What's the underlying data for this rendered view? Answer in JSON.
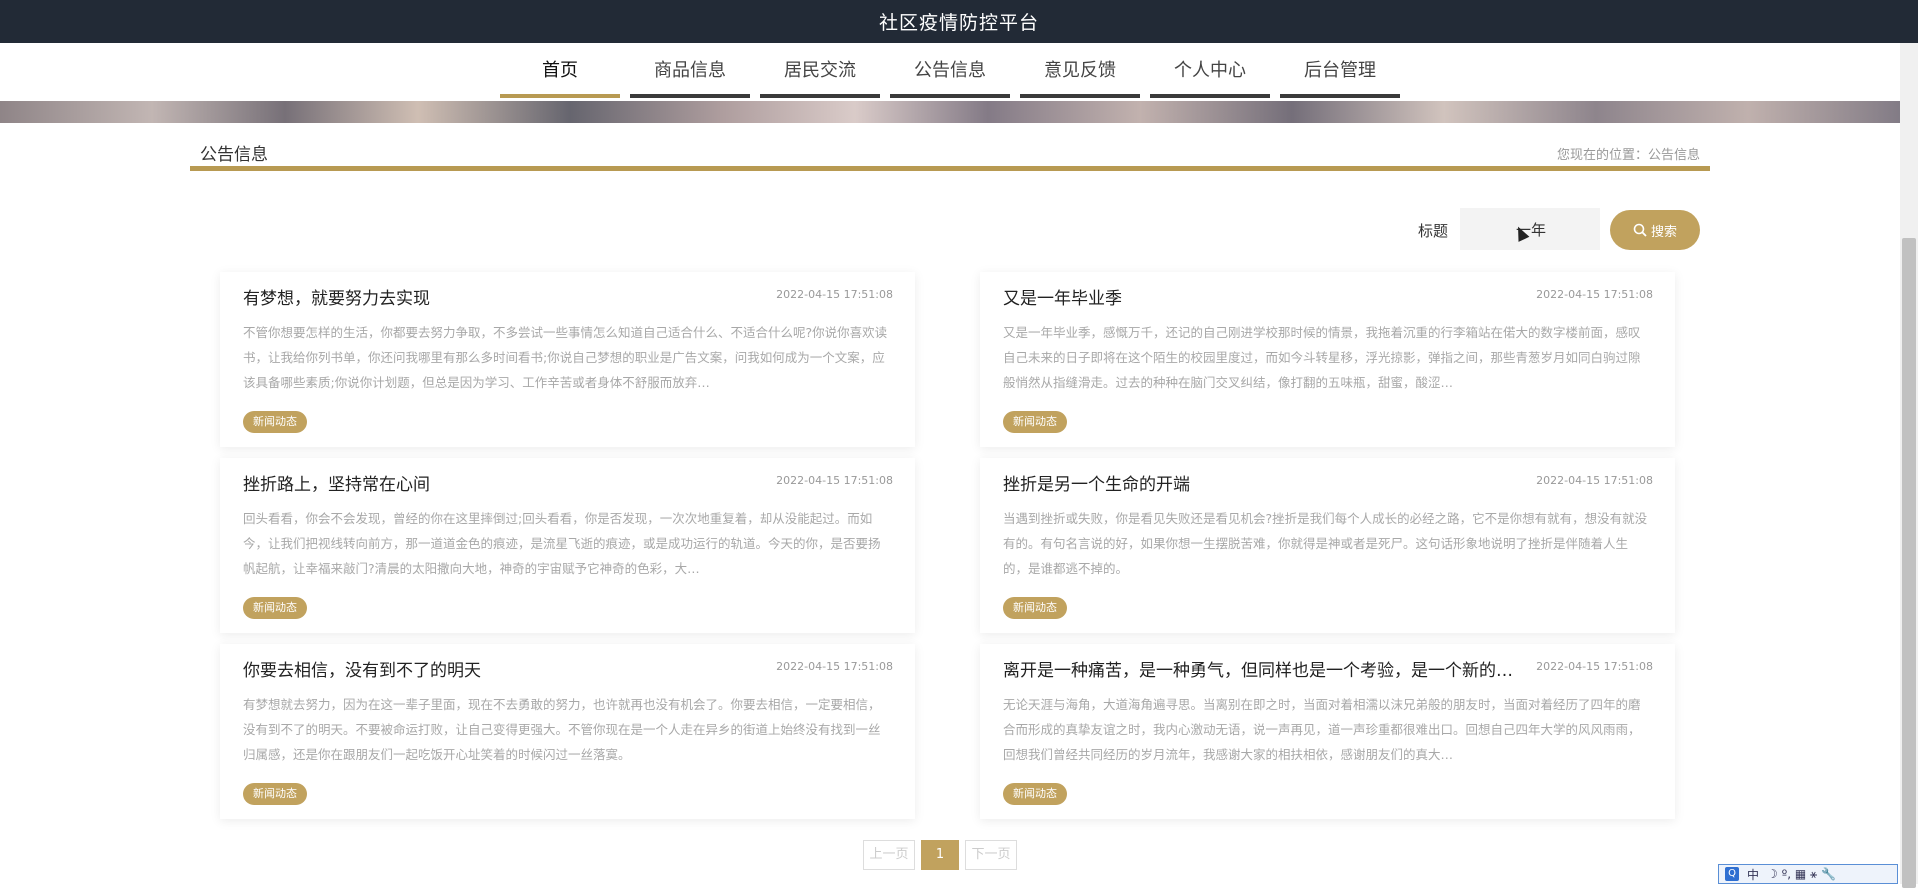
{
  "header": {
    "title": "社区疫情防控平台"
  },
  "nav": {
    "items": [
      "首页",
      "商品信息",
      "居民交流",
      "公告信息",
      "意见反馈",
      "个人中心",
      "后台管理"
    ]
  },
  "section": {
    "title": "公告信息",
    "breadcrumb": "您现在的位置：公告信息"
  },
  "search": {
    "label": "标题",
    "value": "一年",
    "button_label": "搜索"
  },
  "cards": [
    {
      "title": "有梦想，就要努力去实现",
      "date": "2022-04-15 17:51:08",
      "body": "不管你想要怎样的生活，你都要去努力争取，不多尝试一些事情怎么知道自己适合什么、不适合什么呢?你说你喜欢读书，让我给你列书单，你还问我哪里有那么多时间看书;你说自己梦想的职业是广告文案，问我如何成为一个文案，应该具备哪些素质;你说你计划题，但总是因为学习、工作辛苦或者身体不舒服而放弃…",
      "tag": "新闻动态"
    },
    {
      "title": "又是一年毕业季",
      "date": "2022-04-15 17:51:08",
      "body": "又是一年毕业季，感慨万千，还记的自己刚进学校那时候的情景，我拖着沉重的行李箱站在偌大的数字楼前面，感叹自己未来的日子即将在这个陌生的校园里度过，而如今斗转星移，浮光掠影，弹指之间，那些青葱岁月如同白驹过隙般悄然从指缝滑走。过去的种种在脑门交叉纠结，像打翻的五味瓶，甜蜜，酸涩…",
      "tag": "新闻动态"
    },
    {
      "title": "挫折路上，坚持常在心间",
      "date": "2022-04-15 17:51:08",
      "body": "回头看看，你会不会发现，曾经的你在这里摔倒过;回头看看，你是否发现，一次次地重复着，却从没能起过。而如今，让我们把视线转向前方，那一道道金色的痕迹，是流星飞逝的痕迹，或是成功运行的轨道。今天的你，是否要扬帆起航，让幸福来敲门?清晨的太阳撒向大地，神奇的宇宙赋予它神奇的色彩，大…",
      "tag": "新闻动态"
    },
    {
      "title": "挫折是另一个生命的开端",
      "date": "2022-04-15 17:51:08",
      "body": "当遇到挫折或失败，你是看见失败还是看见机会?挫折是我们每个人成长的必经之路，它不是你想有就有，想没有就没有的。有句名言说的好，如果你想一生摆脱苦难，你就得是神或者是死尸。这句话形象地说明了挫折是伴随着人生的，是谁都逃不掉的。",
      "tag": "新闻动态"
    },
    {
      "title": "你要去相信，没有到不了的明天",
      "date": "2022-04-15 17:51:08",
      "body": "有梦想就去努力，因为在这一辈子里面，现在不去勇敢的努力，也许就再也没有机会了。你要去相信，一定要相信，没有到不了的明天。不要被命运打败，让自己变得更强大。不管你现在是一个人走在异乡的街道上始终没有找到一丝归属感，还是你在跟朋友们一起吃饭开心址笑着的时候闪过一丝落寞。",
      "tag": "新闻动态"
    },
    {
      "title": "离开是一种痛苦，是一种勇气，但同样也是一个考验，是一个新的开端",
      "date": "2022-04-15 17:51:08",
      "body": "无论天涯与海角，大道海角遍寻思。当离别在即之时，当面对着相濡以沫兄弟般的朋友时，当面对着经历了四年的磨合而形成的真挚友谊之时，我内心激动无语，说一声再见，道一声珍重都很难出口。回想自己四年大学的风风雨雨，回想我们曾经共同经历的岁月流年，我感谢大家的相扶相依，感谢朋友们的真大…",
      "tag": "新闻动态"
    }
  ],
  "pagination": {
    "prev": "上一页",
    "current": "1",
    "next": "下一页"
  },
  "ime": {
    "logo": "Q",
    "mode": "中",
    "symbols": "☽ º, ▦ ⚹ 🔧"
  }
}
